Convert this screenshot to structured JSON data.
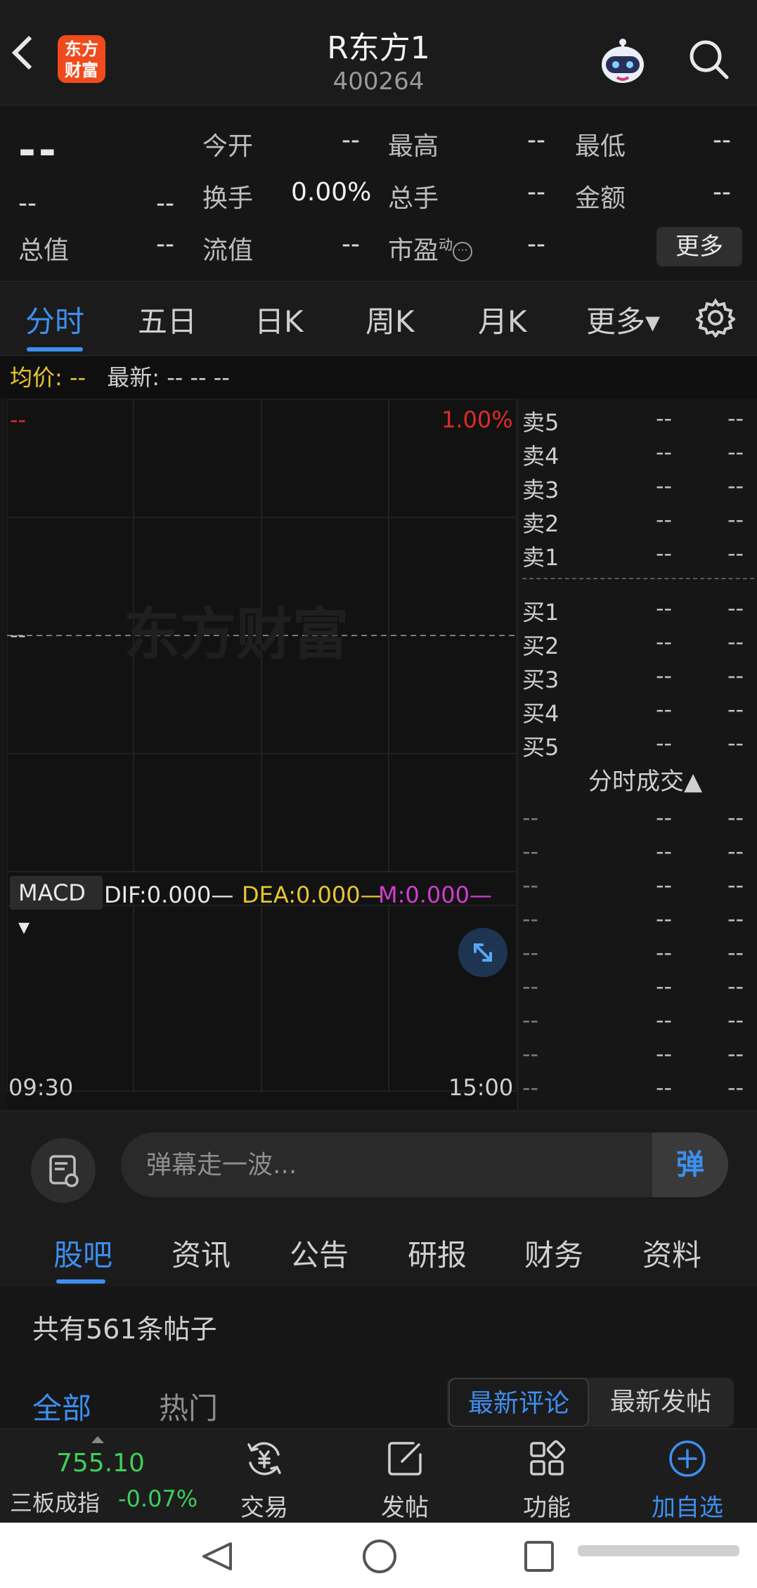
{
  "header": {
    "logo_line1": "东方",
    "logo_line2": "财富",
    "title": "R东方1",
    "code": "400264"
  },
  "quote": {
    "price": "--",
    "change": "--",
    "change_pct": "--",
    "open_label": "今开",
    "open_value": "--",
    "high_label": "最高",
    "high_value": "--",
    "low_label": "最低",
    "low_value": "--",
    "turnover_label": "换手",
    "turnover_value": "0.00%",
    "volume_label": "总手",
    "volume_value": "--",
    "amount_label": "金额",
    "amount_value": "--",
    "mktcap_label": "总值",
    "mktcap_value": "--",
    "float_label": "流值",
    "float_value": "--",
    "pe_label": "市盈",
    "pe_sup": "动",
    "pe_info": "···",
    "pe_value": "--",
    "more_label": "更多"
  },
  "chart_tabs": [
    {
      "label": "分时"
    },
    {
      "label": "五日"
    },
    {
      "label": "日K"
    },
    {
      "label": "周K"
    },
    {
      "label": "月K"
    },
    {
      "label": "更多▾"
    }
  ],
  "avg_bar": {
    "avg_label": "均价:",
    "avg_value": "--",
    "latest_label": "最新:",
    "latest_values": "--  --  --"
  },
  "chart": {
    "top_left": "--",
    "top_right_pct": "1.00%",
    "mid_left": "--",
    "watermark": "东方财富",
    "macd_label": "MACD ▾",
    "dif": "DIF:0.000—",
    "dea": "DEA:0.000—",
    "m": "M:0.000—",
    "time_start": "09:30",
    "time_end": "15:00",
    "colors": {
      "red": "#e02b2b",
      "yellow": "#e8c630",
      "magenta": "#d43bd4",
      "white": "#e8e8e8"
    }
  },
  "order_book": {
    "asks": [
      {
        "label": "卖5",
        "price": "--",
        "vol": "--"
      },
      {
        "label": "卖4",
        "price": "--",
        "vol": "--"
      },
      {
        "label": "卖3",
        "price": "--",
        "vol": "--"
      },
      {
        "label": "卖2",
        "price": "--",
        "vol": "--"
      },
      {
        "label": "卖1",
        "price": "--",
        "vol": "--"
      }
    ],
    "bids": [
      {
        "label": "买1",
        "price": "--",
        "vol": "--"
      },
      {
        "label": "买2",
        "price": "--",
        "vol": "--"
      },
      {
        "label": "买3",
        "price": "--",
        "vol": "--"
      },
      {
        "label": "买4",
        "price": "--",
        "vol": "--"
      },
      {
        "label": "买5",
        "price": "--",
        "vol": "--"
      }
    ],
    "trades_title": "分时成交▲",
    "trades": [
      {
        "t": "--",
        "p": "--",
        "v": "--"
      },
      {
        "t": "--",
        "p": "--",
        "v": "--"
      },
      {
        "t": "--",
        "p": "--",
        "v": "--"
      },
      {
        "t": "--",
        "p": "--",
        "v": "--"
      },
      {
        "t": "--",
        "p": "--",
        "v": "--"
      },
      {
        "t": "--",
        "p": "--",
        "v": "--"
      },
      {
        "t": "--",
        "p": "--",
        "v": "--"
      },
      {
        "t": "--",
        "p": "--",
        "v": "--"
      },
      {
        "t": "--",
        "p": "--",
        "v": "--"
      }
    ]
  },
  "danmaku": {
    "placeholder": "弹幕走一波...",
    "send_label": "弹"
  },
  "info_tabs": [
    {
      "label": "股吧"
    },
    {
      "label": "资讯"
    },
    {
      "label": "公告"
    },
    {
      "label": "研报"
    },
    {
      "label": "财务"
    },
    {
      "label": "资料"
    }
  ],
  "posts": {
    "count_text": "共有561条帖子",
    "filter_all": "全部",
    "filter_hot": "热门",
    "sort_latest_comment": "最新评论",
    "sort_latest_post": "最新发帖"
  },
  "toolbar": {
    "index_value": "755.10",
    "index_name": "三板成指",
    "index_change": "-0.07%",
    "trade_label": "交易",
    "post_label": "发帖",
    "func_label": "功能",
    "add_label": "加自选"
  }
}
